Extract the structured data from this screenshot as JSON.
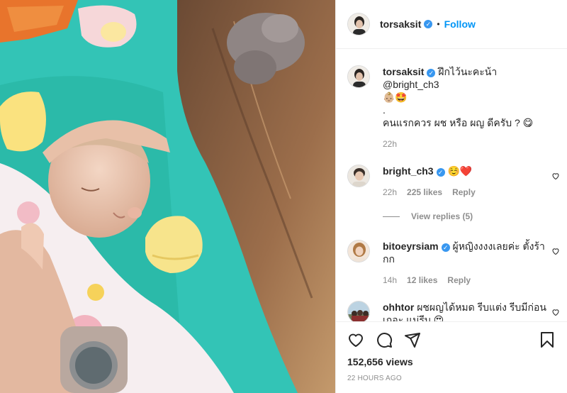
{
  "post": {
    "author": "torsaksit",
    "follow_label": "Follow",
    "dot": "•"
  },
  "caption": {
    "username": "torsaksit",
    "line1": "ฝึกไว้นะคะน้า @bright_ch3",
    "line1_emoji": "👶🏼🤩",
    "line2": ".",
    "line3": "คนแรกควร ผช หรือ ผญ ดีครับ ? 😋",
    "time": "22h"
  },
  "comments": [
    {
      "username": "bright_ch3",
      "text": "☺️❤️",
      "time": "22h",
      "likes": "225 likes",
      "reply": "Reply",
      "view_replies": "View replies (5)"
    },
    {
      "username": "bitoeyrsiam",
      "text": "ผู้หญิงงงงเลยค่ะ ตั้งร้ากก",
      "time": "14h",
      "likes": "12 likes",
      "reply": "Reply"
    },
    {
      "username": "ohhtor",
      "text": "ผชผญได้หมด รีบแต่ง รีบมีก่อนเถอะ แม่รีบ 😍"
    }
  ],
  "stats": {
    "views": "152,656 views",
    "posted": "22 HOURS AGO"
  },
  "icons": {
    "verified": "verified-badge-icon",
    "like": "heart-icon",
    "comment": "comment-icon",
    "share": "share-icon",
    "save": "bookmark-icon"
  },
  "colors": {
    "accent": "#0095f6",
    "verified": "#3897f0",
    "muted": "#8e8e8e",
    "photo_background": "#2fc3b6"
  }
}
